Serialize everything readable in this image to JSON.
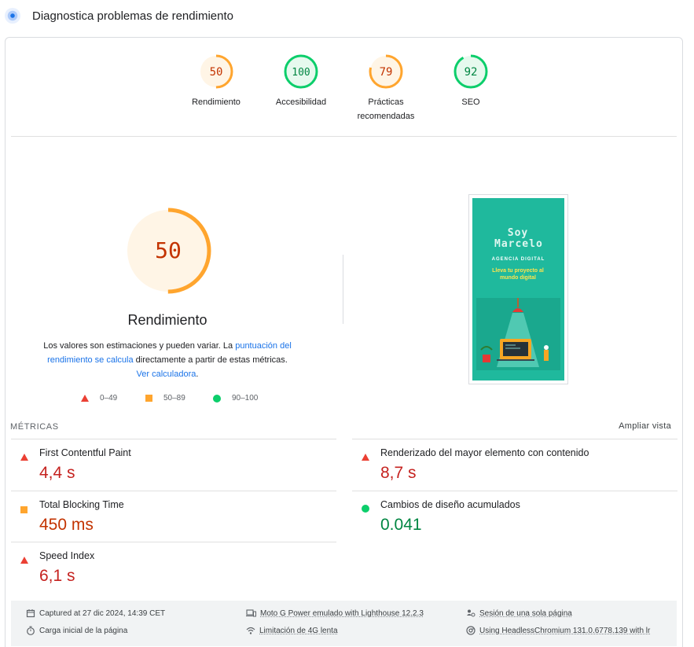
{
  "header": {
    "title": "Diagnostica problemas de rendimiento"
  },
  "categories": [
    {
      "label": "Rendimiento",
      "score": 50,
      "color": "#fa3"
    },
    {
      "label": "Accesibilidad",
      "score": 100,
      "color": "#0cce6b"
    },
    {
      "label": "Prácticas recomendadas",
      "score": 79,
      "color": "#fa3"
    },
    {
      "label": "SEO",
      "score": 92,
      "color": "#0cce6b"
    }
  ],
  "performance": {
    "score": "50",
    "title": "Rendimiento",
    "desc_1": "Los valores son estimaciones y pueden variar. La ",
    "desc_link_1": "puntuación del rendimiento se calcula",
    "desc_2": " directamente a partir de estas métricas. ",
    "desc_link_2": "Ver calculadora",
    "desc_3": "."
  },
  "legend": {
    "fail": "0–49",
    "average": "50–89",
    "pass": "90–100"
  },
  "screenshot": {
    "title": "Soy Marcelo",
    "subtitle": "AGENCIA DIGITAL",
    "tagline": "Lleva tu proyecto al mundo digital"
  },
  "metrics_section": {
    "title": "MÉTRICAS",
    "expand_label": "Ampliar vista"
  },
  "metrics": [
    {
      "name": "First Contentful Paint",
      "value": "4,4 s",
      "status": "fail"
    },
    {
      "name": "Renderizado del mayor elemento con contenido",
      "value": "8,7 s",
      "status": "fail"
    },
    {
      "name": "Total Blocking Time",
      "value": "450 ms",
      "status": "average"
    },
    {
      "name": "Cambios de diseño acumulados",
      "value": "0.041",
      "status": "pass"
    },
    {
      "name": "Speed Index",
      "value": "6,1 s",
      "status": "fail"
    }
  ],
  "footer": {
    "captured": "Captured at 27 dic 2024, 14:39 CET",
    "load": "Carga inicial de la página",
    "device": "Moto G Power emulado with Lighthouse 12.2.3",
    "throttle": "Limitación de 4G lenta",
    "session": "Sesión de una sola página",
    "browser": "Using HeadlessChromium 131.0.6778.139 with lr"
  },
  "colors": {
    "fail": "#c5221f",
    "average": "#c33300",
    "pass": "#018642",
    "gauge_avg": "#ffa52e",
    "gauge_pass": "#0cce6b",
    "link": "#1a73e8"
  }
}
